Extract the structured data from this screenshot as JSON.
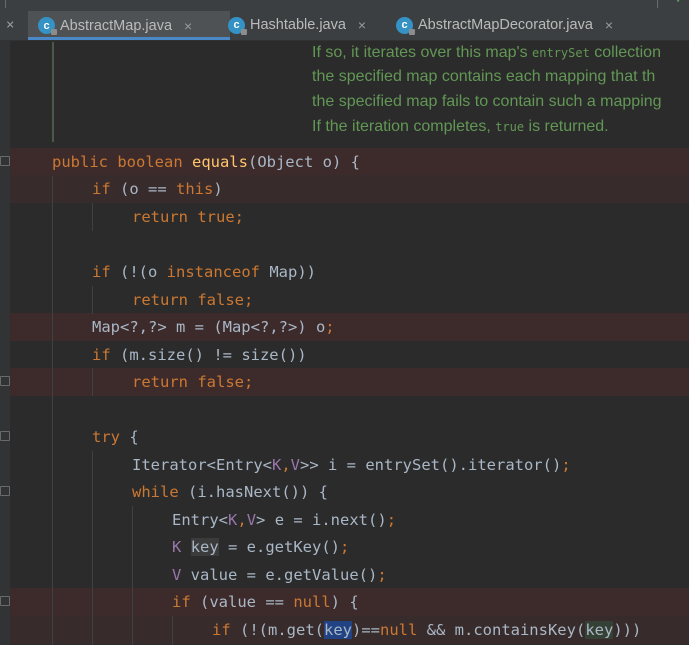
{
  "tabs": [
    {
      "label": "AbstractMap.java",
      "icon": "c-class-icon",
      "active": true
    },
    {
      "label": "Hashtable.java",
      "icon": "c-class-icon",
      "active": false
    },
    {
      "label": "AbstractMapDecorator.java",
      "icon": "c-class-icon",
      "active": false
    }
  ],
  "close_glyph": "×",
  "doc": {
    "line1_pre": "If so, it iterates over this map's ",
    "line1_code": "entrySet",
    "line1_post": " collection",
    "line2": "the specified map contains each mapping that th",
    "line3": "the specified map fails to contain such a mapping",
    "line4_pre": "If the iteration completes, ",
    "line4_code": "true",
    "line4_post": " is returned."
  },
  "code": {
    "l1_kw": "public boolean ",
    "l1_fn": "equals",
    "l1_rest": "(Object o) {",
    "l2_kw": "if",
    "l2_a": " (o == ",
    "l2_kw2": "this",
    "l2_b": ")",
    "l3_kw": "return true",
    "l3_b": ";",
    "l5_kw": "if",
    "l5_a": " (!(o ",
    "l5_kw2": "instanceof",
    "l5_b": " Map))",
    "l6_kw": "return false",
    "l6_b": ";",
    "l7_a": "Map<?,?> m = (Map<?,?>) o",
    "l7_b": ";",
    "l8_kw": "if",
    "l8_a": " (m.size() != size())",
    "l9_kw": "return false",
    "l9_b": ";",
    "l11_kw": "try",
    "l11_a": " {",
    "l12_a": "Iterator<Entry<",
    "l12_k": "K",
    "l12_c": ",",
    "l12_v": "V",
    "l12_b": ">> i = entrySet().iterator()",
    "l12_s": ";",
    "l13_kw": "while",
    "l13_a": " (i.hasNext()) {",
    "l14_a": "Entry<",
    "l14_k": "K",
    "l14_c": ",",
    "l14_v": "V",
    "l14_b": "> e = i.next()",
    "l14_s": ";",
    "l15_k": "K",
    "l15_sp": " ",
    "l15_key": "key",
    "l15_b": " = e.getKey()",
    "l15_s": ";",
    "l16_v": "V",
    "l16_b": " value = e.getValue()",
    "l16_s": ";",
    "l17_kw": "if",
    "l17_a": " (value == ",
    "l17_kw2": "null",
    "l17_b": ") {",
    "l18_kw": "if",
    "l18_a": " (!(m.get(",
    "l18_key": "key",
    "l18_b": ")==",
    "l18_kw2": "null",
    "l18_c": " && m.containsKey(",
    "l18_key2": "key",
    "l18_d": ")))"
  },
  "colors": {
    "background": "#2b2b2b",
    "keyword": "#cc7832",
    "method": "#ffc66d",
    "type_param": "#9876aa",
    "doc_comment": "#629755",
    "breakpoint_line": "#3d2b2b",
    "identifier_highlight": "#214283"
  }
}
